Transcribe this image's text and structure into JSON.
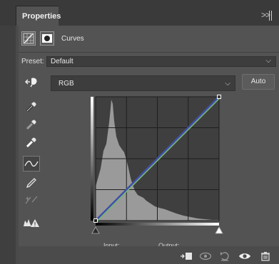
{
  "panel": {
    "tab_label": "Properties",
    "collapse_glyph": ">>"
  },
  "header": {
    "title": "Curves"
  },
  "preset": {
    "label": "Preset:",
    "value": "Default"
  },
  "channel": {
    "value": "RGB"
  },
  "auto_button": {
    "label": "Auto"
  },
  "tools": [
    "targeted-adjustment",
    "sample-black-point",
    "sample-gray-point",
    "sample-white-point",
    "edit-points-curve",
    "draw-curve",
    "smooth-curve",
    "clipping-warning"
  ],
  "curve": {
    "input_label": "Input:",
    "output_label": "Output:",
    "points": [
      {
        "input": 0,
        "output": 0
      },
      {
        "input": 255,
        "output": 255
      }
    ],
    "colors": {
      "composite": "#3f4ea6",
      "red": "#b08a3a",
      "green": "#6bbf6a",
      "blue": "#3f58c6",
      "baseline": "#8aa0c8"
    }
  },
  "bottom_icons": [
    "clip-to-layer-icon",
    "toggle-visibility-icon",
    "reset-icon",
    "eye-icon",
    "trash-icon"
  ]
}
